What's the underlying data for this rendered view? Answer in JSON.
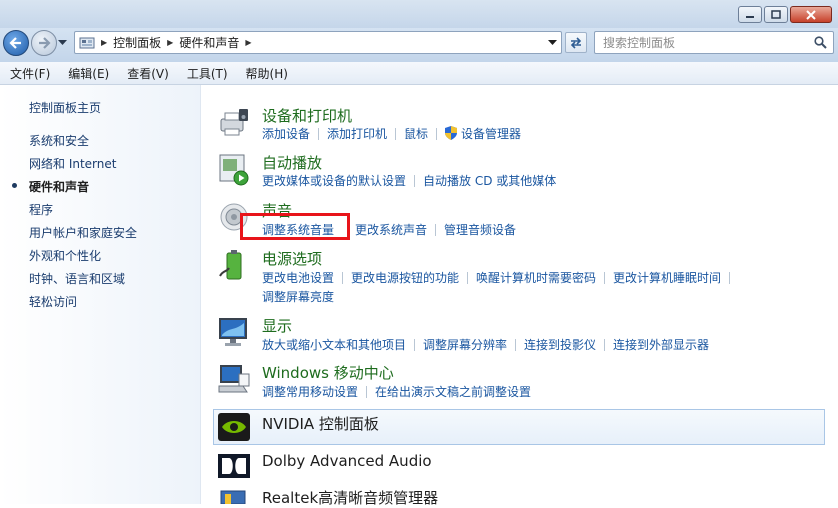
{
  "window": {
    "minimize_icon": "minimize-icon",
    "maximize_icon": "maximize-icon",
    "close_icon": "close-icon"
  },
  "nav": {
    "breadcrumb": [
      "控制面板",
      "硬件和声音"
    ],
    "search_placeholder": "搜索控制面板"
  },
  "menu": [
    "文件(F)",
    "编辑(E)",
    "查看(V)",
    "工具(T)",
    "帮助(H)"
  ],
  "sidebar": {
    "items": [
      {
        "label": "控制面板主页",
        "active": false
      },
      {
        "label": "系统和安全",
        "active": false
      },
      {
        "label": "网络和 Internet",
        "active": false
      },
      {
        "label": "硬件和声音",
        "active": true
      },
      {
        "label": "程序",
        "active": false
      },
      {
        "label": "用户帐户和家庭安全",
        "active": false
      },
      {
        "label": "外观和个性化",
        "active": false
      },
      {
        "label": "时钟、语言和区域",
        "active": false
      },
      {
        "label": "轻松访问",
        "active": false
      }
    ]
  },
  "categories": {
    "devices": {
      "title": "设备和打印机",
      "links": [
        "添加设备",
        "添加打印机",
        "鼠标",
        "设备管理器"
      ]
    },
    "autoplay": {
      "title": "自动播放",
      "links": [
        "更改媒体或设备的默认设置",
        "自动播放 CD 或其他媒体"
      ]
    },
    "sound": {
      "title": "声音",
      "links": [
        "调整系统音量",
        "更改系统声音",
        "管理音频设备"
      ]
    },
    "power": {
      "title": "电源选项",
      "links": [
        "更改电池设置",
        "更改电源按钮的功能",
        "唤醒计算机时需要密码",
        "更改计算机睡眠时间",
        "调整屏幕亮度"
      ]
    },
    "display": {
      "title": "显示",
      "links": [
        "放大或缩小文本和其他项目",
        "调整屏幕分辨率",
        "连接到投影仪",
        "连接到外部显示器"
      ]
    },
    "mobility": {
      "title": "Windows 移动中心",
      "links": [
        "调整常用移动设置",
        "在给出演示文稿之前调整设置"
      ]
    },
    "nvidia": {
      "title": "NVIDIA 控制面板"
    },
    "dolby": {
      "title": "Dolby Advanced Audio"
    },
    "realtek": {
      "title": "Realtek高清晰音频管理器"
    }
  },
  "colors": {
    "category_title": "#1e6c1e",
    "link": "#1a56a0",
    "highlight_box": "#e8141a"
  }
}
